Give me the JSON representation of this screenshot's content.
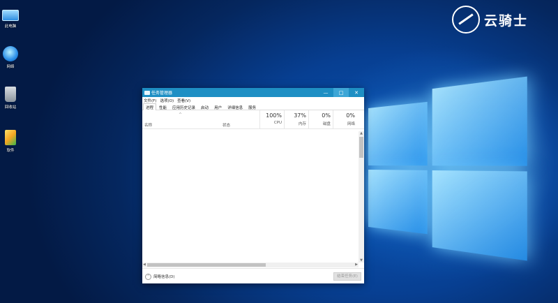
{
  "desktop": {
    "icons": [
      {
        "label": "此电脑",
        "icon": "computer-icon"
      },
      {
        "label": "网络",
        "icon": "network-icon"
      },
      {
        "label": "回收站",
        "icon": "recycle-bin-icon"
      },
      {
        "label": "软件",
        "icon": "folder-icon"
      }
    ],
    "brand_text": "云骑士"
  },
  "window": {
    "title": "任务管理器",
    "controls": {
      "minimize": "—",
      "maximize": "□",
      "close": "✕"
    },
    "menu": [
      "文件(F)",
      "选项(O)",
      "查看(V)"
    ],
    "tabs": [
      "进程",
      "性能",
      "应用历史记录",
      "启动",
      "用户",
      "详细信息",
      "服务"
    ],
    "active_tab": "进程",
    "columns": {
      "sort_indicator": "^",
      "name": "名称",
      "status": "状态",
      "metrics": [
        {
          "value": "100%",
          "label": "CPU"
        },
        {
          "value": "37%",
          "label": "内存"
        },
        {
          "value": "0%",
          "label": "磁盘"
        },
        {
          "value": "0%",
          "label": "网络"
        }
      ]
    },
    "footer": {
      "fewer_details_icon": "chevron-up-icon",
      "fewer_details": "简略信息(D)",
      "end_task": "结束任务(E)"
    }
  },
  "colors": {
    "titlebar": "#1e8fc4",
    "desktop_blue": "#073f92"
  }
}
